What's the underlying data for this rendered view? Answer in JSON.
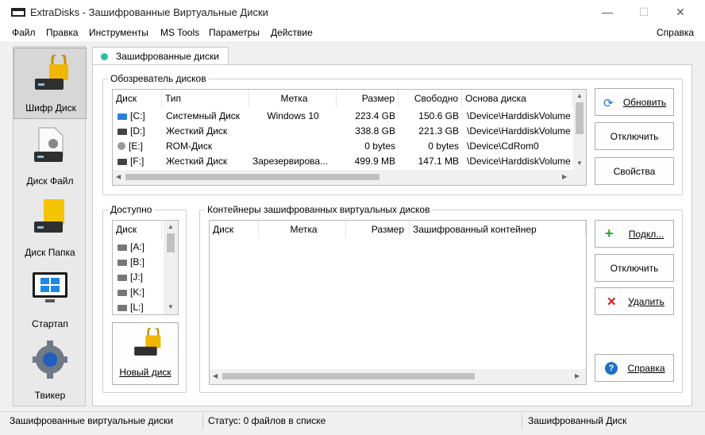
{
  "window": {
    "title": "ExtraDisks - Зашифрованные Виртуальные Диски",
    "minimize": "—",
    "maximize": "☐",
    "close": "✕"
  },
  "menu": [
    "Файл",
    "Правка",
    "Инструменты",
    "MS Tools",
    "Параметры",
    "Действие"
  ],
  "menu_right": "Справка",
  "sidebar": [
    {
      "label": "Шифр Диск",
      "icon": "encrypted-disk-icon",
      "active": true
    },
    {
      "label": "Диск Файл",
      "icon": "file-disk-icon"
    },
    {
      "label": "Диск Папка",
      "icon": "folder-disk-icon"
    },
    {
      "label": "Стартап",
      "icon": "startup-icon"
    },
    {
      "label": "Твикер",
      "icon": "tweaker-gear-icon"
    }
  ],
  "tab": {
    "label": "Зашифрованные диски"
  },
  "disk_browser": {
    "legend": "Обозреватель дисков",
    "columns": [
      "Диск",
      "Тип",
      "Метка",
      "Размер",
      "Свободно",
      "Основа диска"
    ],
    "rows": [
      {
        "disk": "[C:]",
        "type": "Системный Диск",
        "label": "Windows 10",
        "size": "223.4 GB",
        "free": "150.6 GB",
        "base": "\\Device\\HarddiskVolume"
      },
      {
        "disk": "[D:]",
        "type": "Жесткий Диск",
        "label": "",
        "size": "338.8 GB",
        "free": "221.3 GB",
        "base": "\\Device\\HarddiskVolume"
      },
      {
        "disk": "[E:]",
        "type": "ROM-Диск",
        "label": "",
        "size": "0 bytes",
        "free": "0 bytes",
        "base": "\\Device\\CdRom0"
      },
      {
        "disk": "[F:]",
        "type": "Жесткий Диск",
        "label": "Зарезервирова...",
        "size": "499.9 MB",
        "free": "147.1 MB",
        "base": "\\Device\\HarddiskVolume"
      }
    ],
    "buttons": {
      "refresh": "Обновить",
      "disconnect": "Отключить",
      "properties": "Свойства"
    }
  },
  "available": {
    "legend": "Доступно",
    "column": "Диск",
    "items": [
      "[A:]",
      "[B:]",
      "[J:]",
      "[K:]",
      "[L:]"
    ],
    "new_disk": "Новый диск"
  },
  "containers": {
    "legend": "Контейнеры зашифрованных виртуальных дисков",
    "columns": [
      "Диск",
      "Метка",
      "Размер",
      "Зашифрованный контейнер"
    ],
    "buttons": {
      "connect": "Подкл...",
      "disconnect": "Отключить",
      "delete": "Удалить",
      "help": "Справка"
    }
  },
  "status": {
    "left": "Зашифрованные виртуальные диски",
    "middle": "Статус: 0 файлов в списке",
    "right": "Зашифрованный Диск"
  },
  "colors": {
    "accent_tab_dot": "#29c0a0",
    "refresh_icon": "#1e6fc8",
    "connect_icon": "#2aa52a",
    "delete_icon": "#d21f1f",
    "help_icon": "#1e6fc8",
    "lock": "#f2b600"
  }
}
